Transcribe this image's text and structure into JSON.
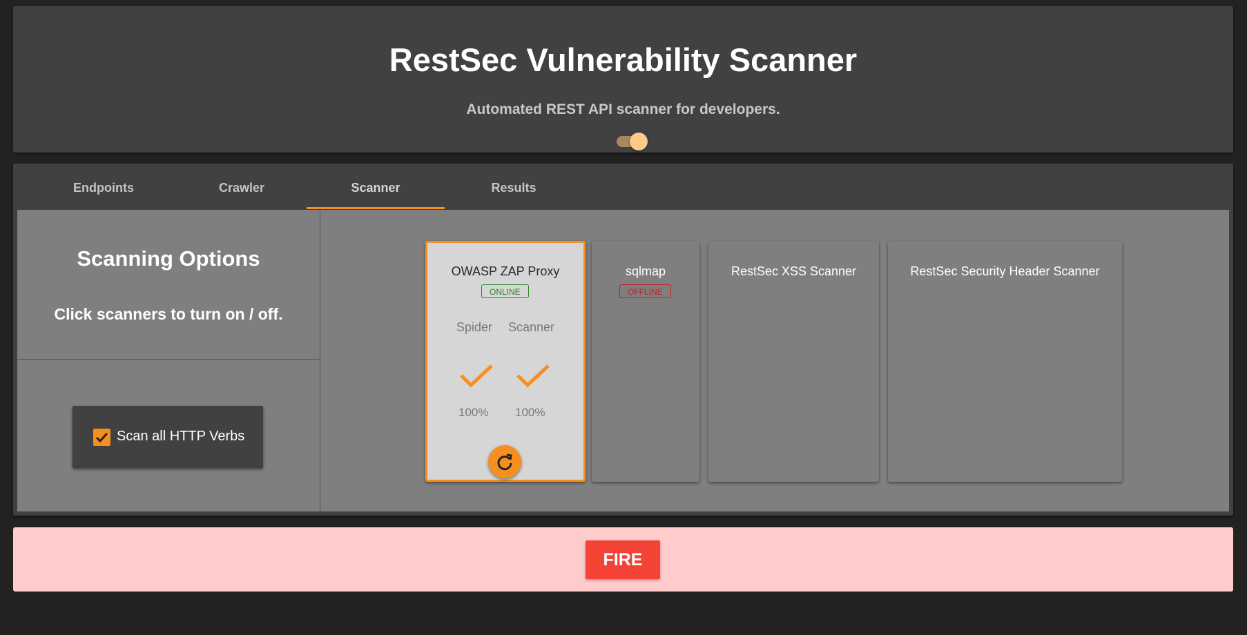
{
  "header": {
    "title": "RestSec Vulnerability Scanner",
    "subtitle": "Automated REST API scanner for developers.",
    "theme_toggle_on": true
  },
  "tabs": [
    {
      "label": "Endpoints",
      "active": false
    },
    {
      "label": "Crawler",
      "active": false
    },
    {
      "label": "Scanner",
      "active": true
    },
    {
      "label": "Results",
      "active": false
    }
  ],
  "options": {
    "title": "Scanning Options",
    "hint": "Click scanners to turn on / off.",
    "scan_all_verbs": {
      "label": "Scan all HTTP Verbs",
      "checked": true
    }
  },
  "scanners": [
    {
      "name": "OWASP ZAP Proxy",
      "status": "ONLINE",
      "selected": true,
      "stats": [
        {
          "label": "Spider",
          "progress": "100%",
          "icon": "check-icon"
        },
        {
          "label": "Scanner",
          "progress": "100%",
          "icon": "check-icon"
        }
      ],
      "action_icon": "refresh-icon"
    },
    {
      "name": "sqlmap",
      "status": "OFFLINE",
      "selected": false
    },
    {
      "name": "RestSec XSS Scanner",
      "selected": false
    },
    {
      "name": "RestSec Security Header Scanner",
      "selected": false
    }
  ],
  "fire": {
    "label": "FIRE"
  },
  "colors": {
    "accent": "#f5901e",
    "online": "#1e8b1e",
    "offline": "#cc1b1b",
    "fire": "#f44336"
  }
}
